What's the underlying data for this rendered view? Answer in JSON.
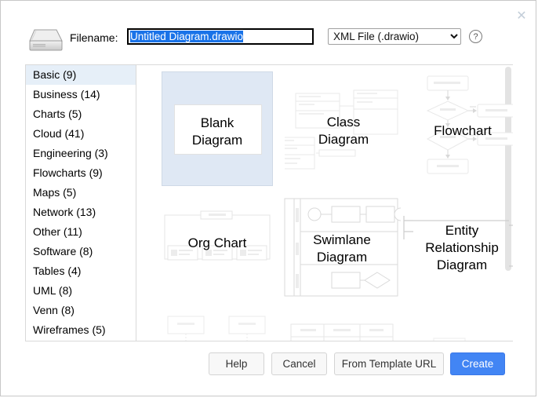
{
  "dialog": {
    "close_label": "✕"
  },
  "header": {
    "drive_icon": "hard-drive-icon",
    "filename_label": "Filename:",
    "filename_value": "Untitled Diagram.drawio",
    "filename_placeholder": "Filename",
    "filetype_selected": "XML File (.drawio)",
    "filetype_options": [
      "XML File (.drawio)"
    ],
    "help_icon_label": "?"
  },
  "sidebar": {
    "items": [
      {
        "label": "Basic (9)",
        "selected": true
      },
      {
        "label": "Business (14)",
        "selected": false
      },
      {
        "label": "Charts (5)",
        "selected": false
      },
      {
        "label": "Cloud (41)",
        "selected": false
      },
      {
        "label": "Engineering (3)",
        "selected": false
      },
      {
        "label": "Flowcharts (9)",
        "selected": false
      },
      {
        "label": "Maps (5)",
        "selected": false
      },
      {
        "label": "Network (13)",
        "selected": false
      },
      {
        "label": "Other (11)",
        "selected": false
      },
      {
        "label": "Software (8)",
        "selected": false
      },
      {
        "label": "Tables (4)",
        "selected": false
      },
      {
        "label": "UML (8)",
        "selected": false
      },
      {
        "label": "Venn (8)",
        "selected": false
      },
      {
        "label": "Wireframes (5)",
        "selected": false
      }
    ]
  },
  "templates": {
    "items": [
      {
        "label_line1": "Blank",
        "label_line2": "Diagram",
        "selected": true
      },
      {
        "label_line1": "Class",
        "label_line2": "Diagram",
        "selected": false
      },
      {
        "label_line1": "Flowchart",
        "label_line2": "",
        "selected": false
      },
      {
        "label_line1": "Org Chart",
        "label_line2": "",
        "selected": false
      },
      {
        "label_line1": "Swimlane",
        "label_line2": "Diagram",
        "selected": false
      },
      {
        "label_line1": "Entity",
        "label_line2": "Relationship",
        "label_line3": "Diagram",
        "selected": false
      }
    ]
  },
  "footer": {
    "help": "Help",
    "cancel": "Cancel",
    "from_template_url": "From Template URL",
    "create": "Create"
  },
  "colors": {
    "accent": "#4285f4",
    "selection_blue": "#1a73e8",
    "tile_selected_bg": "#dfe8f4",
    "sidebar_selected_bg": "#e6eff8",
    "preview_stroke": "#e8e8e8",
    "border": "#d9d9d9"
  }
}
